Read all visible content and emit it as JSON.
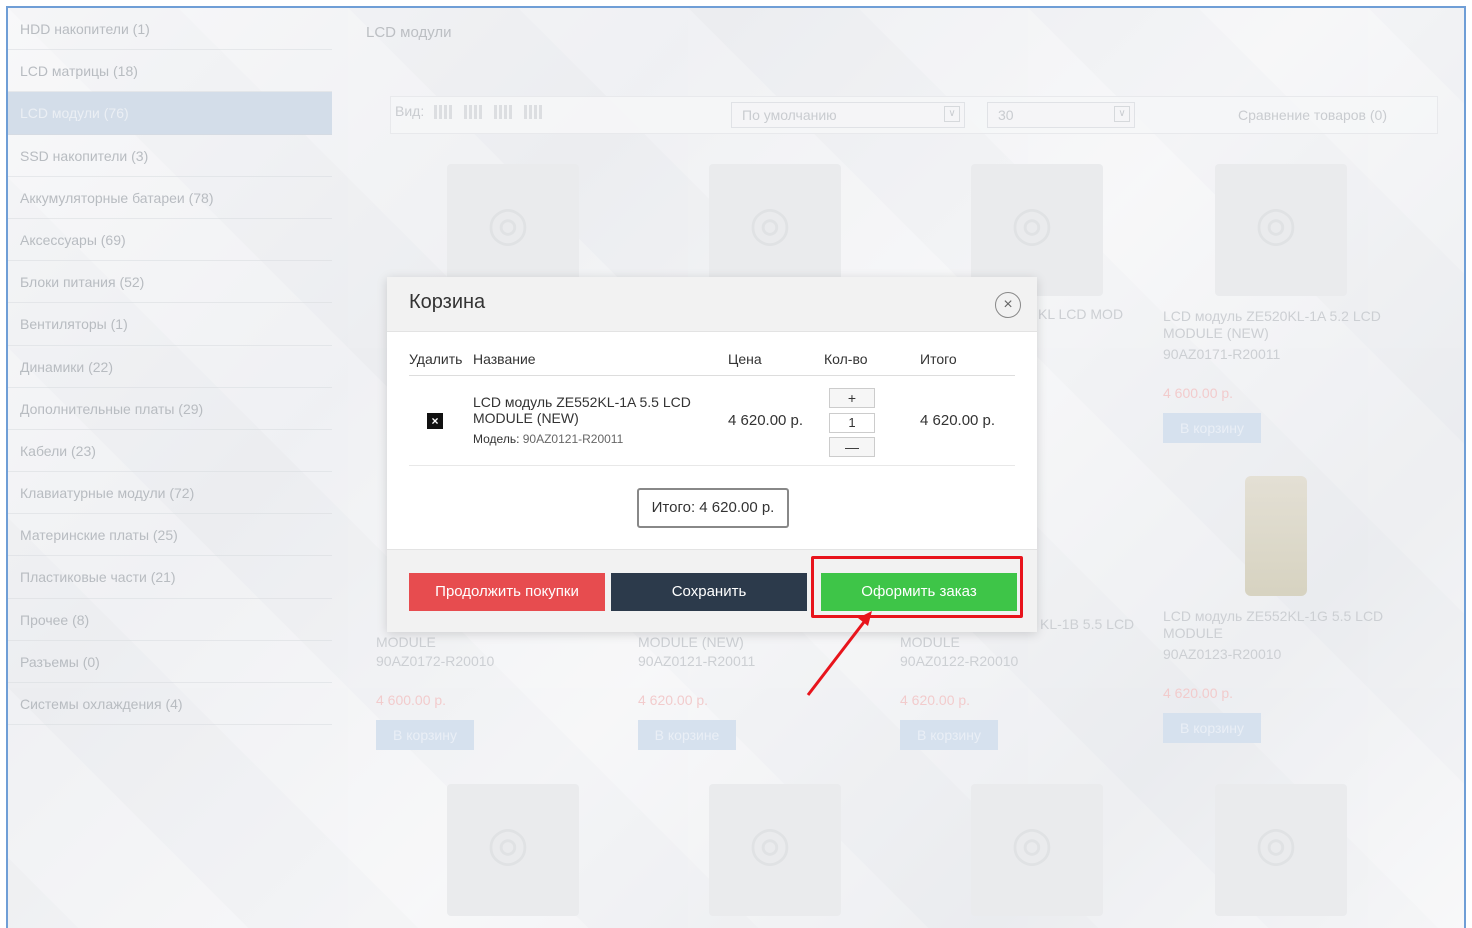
{
  "sidebar": {
    "items": [
      {
        "label": "HDD накопители (1)"
      },
      {
        "label": "LCD матрицы (18)"
      },
      {
        "label": "LCD модули (76)"
      },
      {
        "label": "SSD накопители (3)"
      },
      {
        "label": "Аккумуляторные батареи (78)"
      },
      {
        "label": "Аксессуары (69)"
      },
      {
        "label": "Блоки питания (52)"
      },
      {
        "label": "Вентиляторы (1)"
      },
      {
        "label": "Динамики (22)"
      },
      {
        "label": "Дополнительные платы (29)"
      },
      {
        "label": "Кабели (23)"
      },
      {
        "label": "Клавиатурные модули (72)"
      },
      {
        "label": "Материнские платы (25)"
      },
      {
        "label": "Пластиковые части (21)"
      },
      {
        "label": "Прочее (8)"
      },
      {
        "label": "Разъемы (0)"
      },
      {
        "label": "Системы охлаждения (4)"
      }
    ]
  },
  "breadcrumb": "LCD модули",
  "toolbar": {
    "view_label": "Вид:",
    "sort_value": "По умолчанию",
    "limit_value": "30",
    "compare_label": "Сравнение товаров (0)"
  },
  "products": [
    {
      "name": "LCD модуль ZE520KL-1A 5.2 LCD MODULE (NEW)",
      "model": "90AZ0171-R20011",
      "price": "4 600.00 р.",
      "buy": "В корзину"
    },
    {
      "name": "MODULE",
      "model": "90AZ0172-R20010",
      "price": "4 600.00 р.",
      "buy": "В корзину"
    },
    {
      "name": "MODULE (NEW)",
      "model": "90AZ0121-R20011",
      "price": "4 620.00 р.",
      "buy": "В корзине"
    },
    {
      "name": "MODULE",
      "model": "90AZ0122-R20010",
      "price": "4 620.00 р.",
      "buy": "В корзину"
    },
    {
      "name": "LCD модуль ZE552KL-1G 5.5 LCD MODULE",
      "model": "90AZ0123-R20010",
      "price": "4 620.00 р.",
      "buy": "В корзину"
    }
  ],
  "peek_texts": {
    "t1": "KL LCD MOD",
    "t2": "KL-1B 5.5 LCD"
  },
  "modal": {
    "title": "Корзина",
    "close_icon": "×",
    "headers": {
      "delete": "Удалить",
      "name": "Название",
      "price": "Цена",
      "qty": "Кол-во",
      "total": "Итого"
    },
    "item": {
      "name": "LCD модуль ZE552KL-1A 5.5 LCD MODULE (NEW)",
      "model_label": "Модель:",
      "model": "90AZ0121-R20011",
      "price": "4 620.00 р.",
      "qty": "1",
      "total": "4 620.00 р."
    },
    "qty_plus": "+",
    "qty_minus": "—",
    "delete_icon": "×",
    "sum": "Итого: 4 620.00 р.",
    "buttons": {
      "continue": "Продолжить покупки",
      "save": "Сохранить",
      "checkout": "Оформить заказ"
    }
  },
  "colors": {
    "checkout": "#3ec548",
    "continue": "#e74c4f",
    "save": "#2c3a4b",
    "highlight": "#e8141c"
  }
}
